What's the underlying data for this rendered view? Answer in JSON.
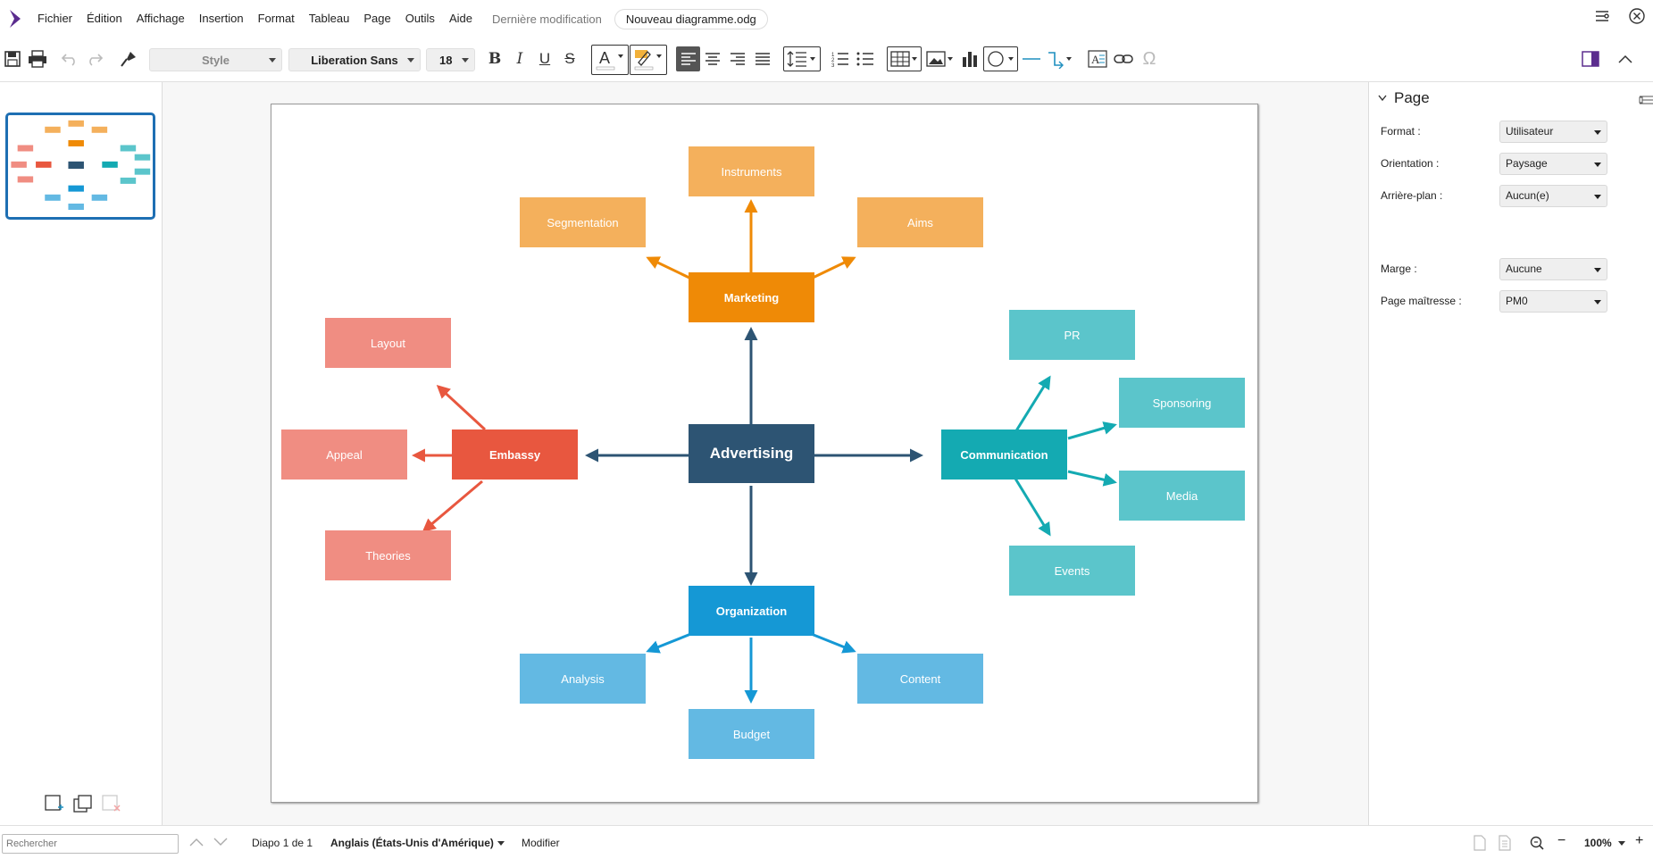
{
  "menubar": {
    "items": [
      "Fichier",
      "Édition",
      "Affichage",
      "Insertion",
      "Format",
      "Tableau",
      "Page",
      "Outils",
      "Aide"
    ],
    "last_modified": "Dernière modification",
    "document_name": "Nouveau diagramme.odg"
  },
  "toolbar": {
    "style_value": "Style",
    "font_name": "Liberation Sans",
    "font_size": "18"
  },
  "diagram": {
    "center": "Advertising",
    "marketing": "Marketing",
    "instruments": "Instruments",
    "segmentation": "Segmentation",
    "aims": "Aims",
    "embassy": "Embassy",
    "layout": "Layout",
    "appeal": "Appeal",
    "theories": "Theories",
    "communication": "Communication",
    "pr": "PR",
    "sponsoring": "Sponsoring",
    "media": "Media",
    "events": "Events",
    "organization": "Organization",
    "analysis": "Analysis",
    "content": "Content",
    "budget": "Budget",
    "colors": {
      "center": "#2d5473",
      "marketing": "#ef8a06",
      "marketing_light": "#f4b05c",
      "embassy": "#e8573f",
      "embassy_light": "#f08d82",
      "communication": "#14aab2",
      "communication_light": "#5bc5cb",
      "organization": "#1598d5",
      "organization_light": "#63b9e3"
    }
  },
  "sidebar": {
    "title": "Page",
    "format_label": "Format :",
    "format_value": "Utilisateur",
    "orientation_label": "Orientation :",
    "orientation_value": "Paysage",
    "background_label": "Arrière-plan :",
    "background_value": "Aucun(e)",
    "margin_label": "Marge :",
    "margin_value": "Aucune",
    "master_label": "Page maîtresse :",
    "master_value": "PM0"
  },
  "statusbar": {
    "search_placeholder": "Rechercher",
    "slide_info": "Diapo 1 de 1",
    "language": "Anglais (États-Unis d'Amérique)",
    "mode": "Modifier",
    "zoom": "100%"
  }
}
